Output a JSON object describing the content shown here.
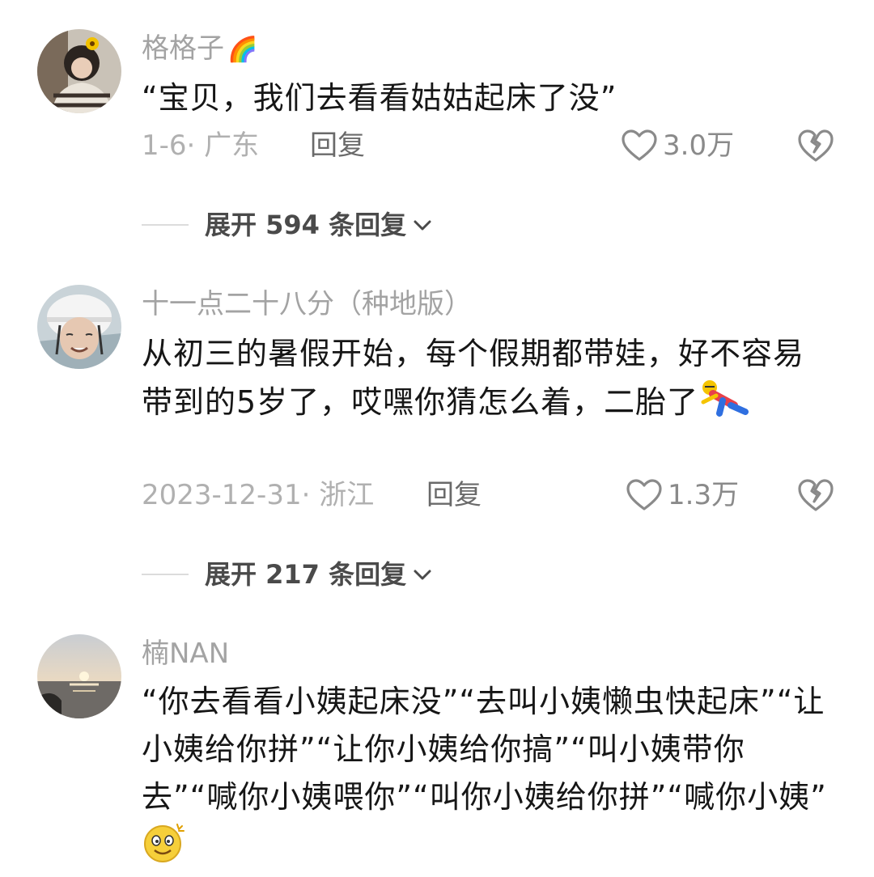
{
  "comments": [
    {
      "username": "格格子",
      "username_emoji": "🌈",
      "content": "“宝贝，我们去看看姑姑起床了没”",
      "date_location": "1-6· 广东",
      "reply_label": "回复",
      "likes": "3.0万",
      "expand_label": "展开 594 条回复"
    },
    {
      "username": "十一点二十八分（种地版）",
      "content": "从初三的暑假开始，每个假期都带娃，好不容易带到的5岁了，哎嘿你猜怎么着，二胎了",
      "date_location": "2023-12-31· 浙江",
      "reply_label": "回复",
      "likes": "1.3万",
      "expand_label": "展开 217 条回复"
    },
    {
      "username": "楠NAN",
      "content": "“你去看看小姨起床没”“去叫小姨懒虫快起床”“让小姨给你拼”“让你小姨给你搞”“叫小姨带你去”“喊你小姨喂你”“叫你小姨给你拼”“喊你小姨”"
    }
  ],
  "colors": {
    "username": "#a3a3a3",
    "content": "#161616",
    "meta": "#b0b0b0",
    "reply": "#6a6a6a",
    "expand": "#4a4a4a"
  },
  "icons": [
    "heart-outline-icon",
    "broken-heart-icon",
    "chevron-down-icon"
  ]
}
